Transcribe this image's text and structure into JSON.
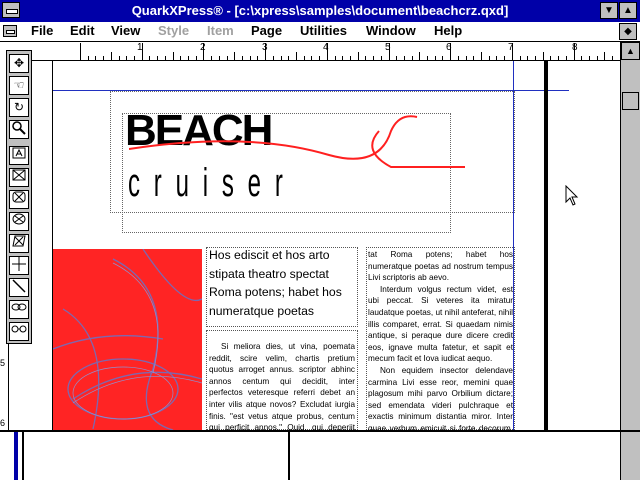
{
  "window": {
    "title": "QuarkXPress® - [c:\\xpress\\samples\\document\\beachcrz.qxd]"
  },
  "menubar": {
    "items": [
      "File",
      "Edit",
      "View",
      "Style",
      "Item",
      "Page",
      "Utilities",
      "Window",
      "Help"
    ]
  },
  "ruler": {
    "labels": [
      "1",
      "2",
      "3",
      "4",
      "5",
      "6",
      "7",
      "8"
    ]
  },
  "vruler": {
    "labels": [
      "5",
      "6"
    ]
  },
  "logo": {
    "word1": "BEACH",
    "word2": "cruiser"
  },
  "headline": {
    "text": "Hos ediscit et hos arto stipata theatro spectat Roma potens; habet hos numeratque poetas"
  },
  "body_left": {
    "text": "Si meliora dies, ut vina, poemata reddit, scire velim, chartis pretium quotus arroget annus. scriptor abhinc annos centum qui decidit, inter perfectos veteresque referri debet an inter vilis atque novos? Excludat iurgia finis. \"est vetus atque probus, centum qui perficit annos.\" Quid, qui deperiit minor uno"
  },
  "body_right": {
    "p1": "tat Roma potens; habet hos numeratque poetas ad nostrum tempus Livi scriptoris ab aevo.",
    "p2": "Interdum volgus rectum videt, est ubi peccat. Si veteres ita miratur laudatque poetas, ut nihil anteferat, nihil illis comparet, errat. Si quaedam nimis antique, si peraque dure dicere credit eos, ignave multa fatetur, et sapit et mecum facit et Iova iudicat aequo.",
    "p3": "Non equidem insector delendave carmina Livi esse reor, memini quae plagosum mihi parvo Orbilium dictare; sed emendata videri pulchraque et exactis minimum distantia miror. Inter quae verbum emicuit si forte decorum, et si"
  },
  "colors": {
    "titlebar": "#0000a8",
    "accent_red": "#ff2020",
    "guide_blue": "#2030c0"
  },
  "icons": [
    "item-tool",
    "content-hand-tool",
    "rotation-tool",
    "zoom-tool",
    "text-box-tool",
    "rectangle-picture-tool",
    "rounded-picture-tool",
    "oval-picture-tool",
    "polygon-picture-tool",
    "orthogonal-line-tool",
    "line-tool",
    "linking-tool",
    "unlinking-tool"
  ]
}
